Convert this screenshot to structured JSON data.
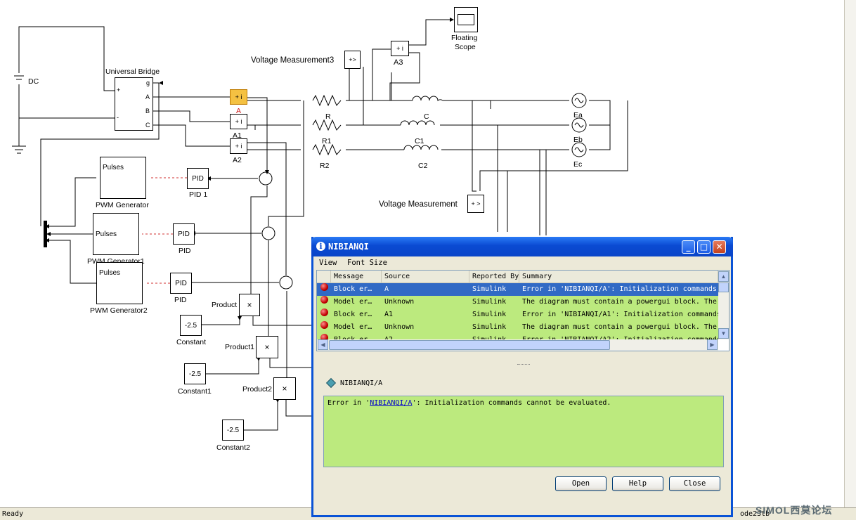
{
  "model": {
    "blocks": {
      "dc": "DC",
      "universal_bridge": "Universal Bridge",
      "bridge_ports": {
        "g": "g",
        "a": "A",
        "b": "B",
        "c": "C",
        "plus": "+",
        "minus": "-"
      },
      "floating_scope": [
        "Floating",
        "Scope"
      ],
      "vm3": "Voltage Measurement3",
      "vm": "Voltage Measurement",
      "a3": "A3",
      "a_block": "A",
      "a1": "A1",
      "a2": "A2",
      "r": "R",
      "r1": "R1",
      "r2": "R2",
      "c": "C",
      "c1": "C1",
      "c2": "C2",
      "ea": "Ea",
      "eb": "Eb",
      "ec": "Ec",
      "pulses": "Pulses",
      "pwm": "PWM Generator",
      "pwm1": "PWM Generator1",
      "pwm2": "PWM Generator2",
      "pid": "PID",
      "pid1": "PID 1",
      "product": "Product",
      "product1": "Product1",
      "product2": "Product2",
      "const_val": "-2.5",
      "constant": "Constant",
      "constant1": "Constant1",
      "constant2": "Constant2",
      "times": "×"
    }
  },
  "statusbar": {
    "ready": "Ready",
    "solver": "ode23tb"
  },
  "watermark": "SIMOL西莫论坛",
  "dialog": {
    "title": "NIBIANQI",
    "menu": {
      "view": "View",
      "font_size": "Font Size"
    },
    "columns": [
      "Message",
      "Source",
      "Reported By",
      "Summary"
    ],
    "rows": [
      {
        "message": "Block er…",
        "source": "A",
        "reported_by": "Simulink",
        "summary": "Error in 'NIBIANQI/A': Initialization commands",
        "selected": true
      },
      {
        "message": "Model er…",
        "source": "Unknown",
        "reported_by": "Simulink",
        "summary": "The diagram must contain a powergui block. The",
        "selected": false
      },
      {
        "message": "Block er…",
        "source": "A1",
        "reported_by": "Simulink",
        "summary": "Error in 'NIBIANQI/A1': Initialization commands",
        "selected": false
      },
      {
        "message": "Model er…",
        "source": "Unknown",
        "reported_by": "Simulink",
        "summary": "The diagram must contain a powergui block. The",
        "selected": false
      },
      {
        "message": "Block er…",
        "source": "A2",
        "reported_by": "Simulink",
        "summary": "Error in 'NIBIANQI/A2': Initialization commands",
        "selected": false
      }
    ],
    "detail_name": "NIBIANQI/A",
    "detail": {
      "prefix": "Error in '",
      "link": "NIBIANQI/A",
      "suffix": "': Initialization commands cannot be evaluated."
    },
    "buttons": {
      "open": "Open",
      "help": "Help",
      "close": "Close"
    },
    "colors": {
      "row_bg": "#bcea7e",
      "selected_bg": "#316ac5",
      "titlebar": "#0a4ad2"
    }
  }
}
